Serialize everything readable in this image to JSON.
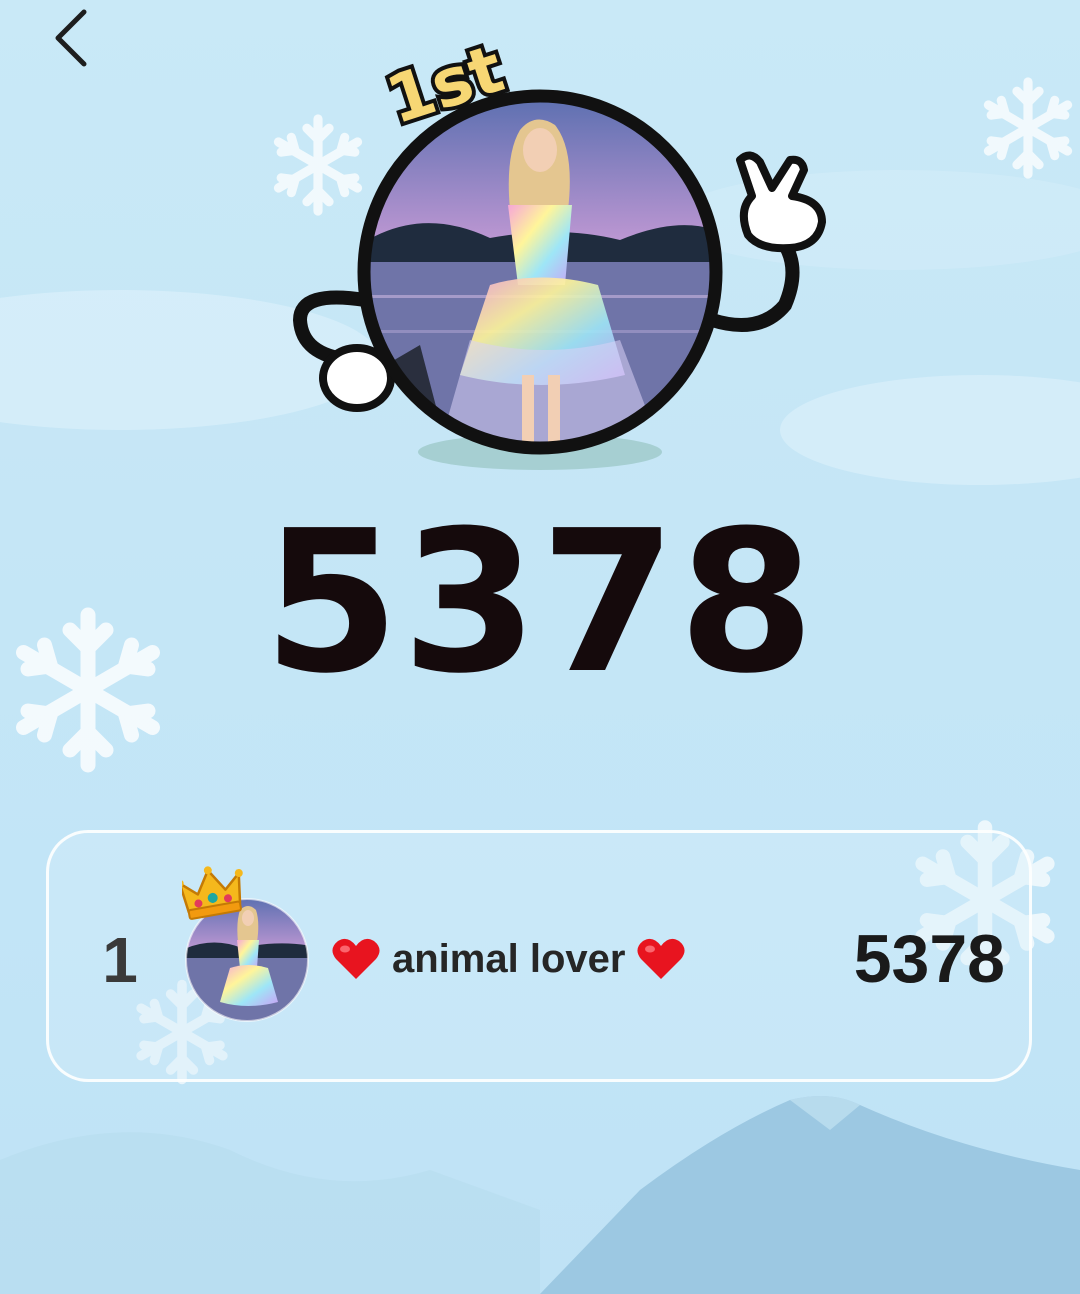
{
  "header": {
    "back_icon": "chevron-left-icon"
  },
  "winner": {
    "place_badge": "1st",
    "score": "5378",
    "avatar": "profile-photo",
    "decor": [
      "peace-hand-icon",
      "hand-icon"
    ]
  },
  "leaderboard": {
    "rows": [
      {
        "rank": "1",
        "crown_icon": "crown-icon",
        "name": "animal lover",
        "name_decor": "heart-icon",
        "score": "5378"
      }
    ]
  },
  "colors": {
    "background": "#c5e6f6",
    "score_text": "#150a0c",
    "badge_fill": "#f7d774",
    "heart": "#e8141f"
  }
}
